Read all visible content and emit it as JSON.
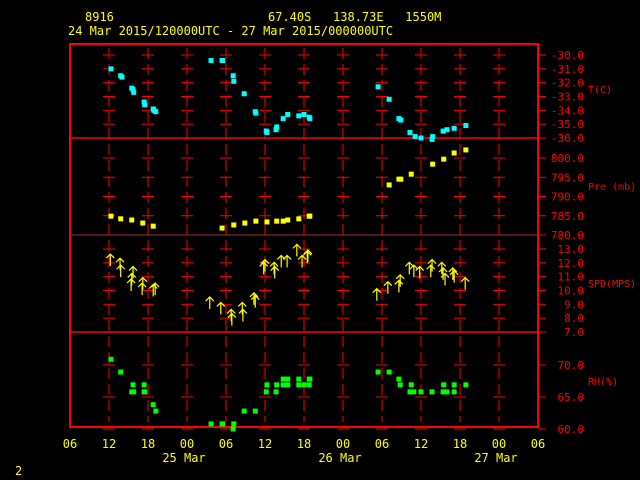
{
  "header": {
    "station": "8916",
    "location": "67.40S   138.73E   1550M",
    "period": "24 Mar 2015/120000UTC - 27 Mar 2015/000000UTC"
  },
  "footer": {
    "page": "2"
  },
  "colors": {
    "axis": "#ff0000",
    "text": "#ffff00",
    "temp": "#00ffff",
    "pressure": "#ffff00",
    "wind": "#ffff00",
    "rh": "#00ff00"
  },
  "chart_data": {
    "type": "scatter",
    "x_unit": "hours since 24 Mar 2015 06 UTC",
    "xlim": [
      0,
      72
    ],
    "x_ticks": [
      {
        "h": 0,
        "label": "06"
      },
      {
        "h": 6,
        "label": "12"
      },
      {
        "h": 12,
        "label": "18"
      },
      {
        "h": 18,
        "label": "00"
      },
      {
        "h": 24,
        "label": "06"
      },
      {
        "h": 30,
        "label": "12"
      },
      {
        "h": 36,
        "label": "18"
      },
      {
        "h": 42,
        "label": "00"
      },
      {
        "h": 48,
        "label": "06"
      },
      {
        "h": 54,
        "label": "12"
      },
      {
        "h": 60,
        "label": "18"
      },
      {
        "h": 66,
        "label": "00"
      },
      {
        "h": 72,
        "label": "06"
      }
    ],
    "date_labels": [
      {
        "h": 18,
        "label": "25 Mar"
      },
      {
        "h": 42,
        "label": "26 Mar"
      },
      {
        "h": 66,
        "label": "27 Mar"
      }
    ],
    "panels": [
      {
        "name": "temperature",
        "label": "T(C)",
        "ylim": [
          -36,
          -30
        ],
        "ticks": [
          -30,
          -31,
          -32,
          -33,
          -34,
          -35,
          -36
        ],
        "tick_labels": [
          "-30.0",
          "-31.0",
          "-32.0",
          "-33.0",
          "-34.0",
          "-35.0",
          "-36.0"
        ],
        "marker": "square",
        "points": [
          [
            6.3,
            -31.0
          ],
          [
            7.8,
            -31.5
          ],
          [
            8.0,
            -31.6
          ],
          [
            9.5,
            -32.4
          ],
          [
            9.7,
            -32.5
          ],
          [
            9.8,
            -32.7
          ],
          [
            11.4,
            -33.4
          ],
          [
            11.5,
            -33.6
          ],
          [
            12.8,
            -33.9
          ],
          [
            12.9,
            -34.0
          ],
          [
            13.2,
            -34.1
          ],
          [
            21.7,
            -30.4
          ],
          [
            23.4,
            -30.4
          ],
          [
            23.5,
            -30.4
          ],
          [
            25.1,
            -31.5
          ],
          [
            25.2,
            -31.9
          ],
          [
            26.8,
            -32.8
          ],
          [
            28.5,
            -34.1
          ],
          [
            28.6,
            -34.2
          ],
          [
            30.2,
            -35.5
          ],
          [
            30.3,
            -35.6
          ],
          [
            31.7,
            -35.4
          ],
          [
            31.8,
            -35.2
          ],
          [
            32.8,
            -34.6
          ],
          [
            33.5,
            -34.3
          ],
          [
            35.2,
            -34.4
          ],
          [
            36.0,
            -34.3
          ],
          [
            36.8,
            -34.5
          ],
          [
            36.9,
            -34.6
          ],
          [
            47.4,
            -32.3
          ],
          [
            49.1,
            -33.2
          ],
          [
            50.6,
            -34.6
          ],
          [
            50.9,
            -34.7
          ],
          [
            52.3,
            -35.6
          ],
          [
            53.1,
            -35.9
          ],
          [
            54.0,
            -36.0
          ],
          [
            55.7,
            -36.1
          ],
          [
            55.8,
            -35.9
          ],
          [
            57.4,
            -35.5
          ],
          [
            58.0,
            -35.4
          ],
          [
            59.1,
            -35.3
          ],
          [
            60.9,
            -35.1
          ]
        ]
      },
      {
        "name": "pressure",
        "label": "Pre (mb)",
        "ylim": [
          780,
          800
        ],
        "ticks": [
          800,
          795,
          790,
          785,
          780
        ],
        "tick_labels": [
          "800.0",
          "795.0",
          "790.0",
          "785.0",
          "780.0"
        ],
        "marker": "square",
        "points": [
          [
            6.3,
            784.9
          ],
          [
            7.8,
            784.2
          ],
          [
            9.5,
            783.9
          ],
          [
            11.2,
            783.1
          ],
          [
            12.8,
            782.3
          ],
          [
            23.4,
            781.8
          ],
          [
            25.2,
            782.6
          ],
          [
            26.9,
            783.1
          ],
          [
            28.6,
            783.6
          ],
          [
            30.3,
            783.4
          ],
          [
            31.8,
            783.6
          ],
          [
            32.8,
            783.6
          ],
          [
            33.5,
            783.9
          ],
          [
            35.2,
            784.2
          ],
          [
            36.8,
            784.9
          ],
          [
            36.9,
            784.9
          ],
          [
            49.1,
            793.0
          ],
          [
            50.6,
            794.5
          ],
          [
            50.9,
            794.5
          ],
          [
            52.5,
            795.8
          ],
          [
            55.8,
            798.4
          ],
          [
            57.5,
            799.7
          ],
          [
            59.1,
            801.3
          ],
          [
            60.9,
            802.1
          ]
        ]
      },
      {
        "name": "wind_speed",
        "label": "SPD(MPS)",
        "ylim": [
          7,
          13
        ],
        "ticks": [
          13,
          12,
          11,
          10,
          9,
          8,
          7
        ],
        "tick_labels": [
          "13.0",
          "12.0",
          "11.0",
          "10.0",
          "9.0",
          "8.0",
          "7.0"
        ],
        "marker": "arrow",
        "points": [
          [
            6.2,
            12.2
          ],
          [
            7.7,
            11.9
          ],
          [
            7.8,
            11.4
          ],
          [
            9.7,
            11.3
          ],
          [
            9.5,
            10.8
          ],
          [
            9.4,
            10.4
          ],
          [
            11.2,
            10.5
          ],
          [
            11.1,
            10.1
          ],
          [
            12.8,
            10.0
          ],
          [
            13.1,
            10.1
          ],
          [
            21.5,
            9.1
          ],
          [
            23.2,
            8.7
          ],
          [
            24.8,
            8.2
          ],
          [
            24.9,
            7.9
          ],
          [
            26.5,
            8.7
          ],
          [
            26.6,
            8.2
          ],
          [
            28.3,
            9.4
          ],
          [
            28.5,
            9.2
          ],
          [
            30.0,
            11.8
          ],
          [
            29.8,
            11.6
          ],
          [
            31.4,
            11.6
          ],
          [
            31.5,
            11.3
          ],
          [
            32.5,
            12.1
          ],
          [
            33.4,
            12.1
          ],
          [
            34.9,
            12.9
          ],
          [
            35.7,
            12.1
          ],
          [
            36.5,
            12.4
          ],
          [
            36.6,
            12.5
          ],
          [
            47.2,
            9.7
          ],
          [
            48.9,
            10.2
          ],
          [
            50.6,
            10.3
          ],
          [
            50.8,
            10.7
          ],
          [
            52.2,
            11.6
          ],
          [
            52.9,
            11.4
          ],
          [
            53.8,
            11.3
          ],
          [
            55.7,
            11.8
          ],
          [
            55.5,
            11.4
          ],
          [
            57.2,
            11.6
          ],
          [
            57.4,
            11.2
          ],
          [
            57.7,
            10.8
          ],
          [
            58.9,
            11.2
          ],
          [
            59.1,
            11.0
          ],
          [
            60.8,
            10.5
          ]
        ]
      },
      {
        "name": "relative_humidity",
        "label": "RH(%)",
        "ylim": [
          60,
          70
        ],
        "ticks": [
          70,
          65,
          60
        ],
        "tick_labels": [
          "70.0",
          "65.0",
          "60.0"
        ],
        "marker": "square",
        "points": [
          [
            6.3,
            70.9
          ],
          [
            7.8,
            68.9
          ],
          [
            9.7,
            66.9
          ],
          [
            9.5,
            65.8
          ],
          [
            9.8,
            65.8
          ],
          [
            11.4,
            66.9
          ],
          [
            11.4,
            65.8
          ],
          [
            11.5,
            65.8
          ],
          [
            12.8,
            63.8
          ],
          [
            13.2,
            62.8
          ],
          [
            21.7,
            60.8
          ],
          [
            23.4,
            60.8
          ],
          [
            23.5,
            60.8
          ],
          [
            25.2,
            60.8
          ],
          [
            25.1,
            60.0
          ],
          [
            26.8,
            62.8
          ],
          [
            28.5,
            62.8
          ],
          [
            30.3,
            66.9
          ],
          [
            30.2,
            65.8
          ],
          [
            31.7,
            65.8
          ],
          [
            31.8,
            66.9
          ],
          [
            32.8,
            67.8
          ],
          [
            33.5,
            67.8
          ],
          [
            32.8,
            66.9
          ],
          [
            33.5,
            66.9
          ],
          [
            35.2,
            67.8
          ],
          [
            35.2,
            66.9
          ],
          [
            36.0,
            66.9
          ],
          [
            36.8,
            67.8
          ],
          [
            36.8,
            66.9
          ],
          [
            36.9,
            67.8
          ],
          [
            47.4,
            68.9
          ],
          [
            49.1,
            68.9
          ],
          [
            50.6,
            67.8
          ],
          [
            50.8,
            66.9
          ],
          [
            52.5,
            66.9
          ],
          [
            52.3,
            65.8
          ],
          [
            52.9,
            65.8
          ],
          [
            54.0,
            65.8
          ],
          [
            55.7,
            65.8
          ],
          [
            57.4,
            65.8
          ],
          [
            58.0,
            65.8
          ],
          [
            57.5,
            66.9
          ],
          [
            59.1,
            66.9
          ],
          [
            59.1,
            65.8
          ],
          [
            60.9,
            66.9
          ]
        ]
      }
    ]
  }
}
